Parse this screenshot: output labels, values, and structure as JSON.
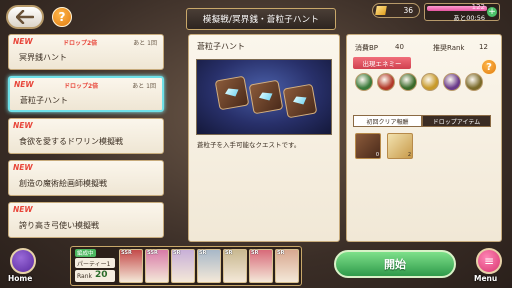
{
  "header": {
    "title": "模擬戦/冥界銭・蒼粒子ハント",
    "gems": "36",
    "stamina_value": "122",
    "stamina_fill": 1.0,
    "stamina_recovery": "あと00:56"
  },
  "quests": [
    {
      "new": "NEW",
      "drop": "ドロップ2倍",
      "remain": "あと 1回",
      "name": "冥界銭ハント"
    },
    {
      "new": "NEW",
      "drop": "ドロップ2倍",
      "remain": "あと 1回",
      "name": "蒼粒子ハント"
    },
    {
      "new": "NEW",
      "drop": "",
      "remain": "",
      "name": "食欲を愛するドワリン模擬戦"
    },
    {
      "new": "NEW",
      "drop": "",
      "remain": "",
      "name": "創造の魔術絵画師模擬戦"
    },
    {
      "new": "NEW",
      "drop": "",
      "remain": "",
      "name": "誇り高き弓使い模擬戦"
    }
  ],
  "detail": {
    "title": "蒼粒子ハント",
    "description": "蒼粒子を入手可能なクエストです。"
  },
  "info": {
    "bp_label": "消費BP",
    "bp_value": "40",
    "rank_label": "推奨Rank",
    "rank_value": "12",
    "enemy_label": "出現エネミー",
    "enemy_colors": [
      "#3a7a3a",
      "#b23a2a",
      "#3a6a2a",
      "#c89a2a",
      "#6a3a8a",
      "#7a6a2a"
    ],
    "tab_first_clear": "初回クリア報酬",
    "tab_drop_items": "ドロップアイテム",
    "drop_items": [
      {
        "type": "card-icon",
        "count": "0"
      },
      {
        "type": "scroll-icon",
        "count": "2"
      }
    ]
  },
  "party": {
    "tag": "編成中",
    "name": "パーティー1",
    "rank_label": "Rank",
    "rank_value": "20",
    "members": [
      {
        "rarity": "SSR",
        "color": "#c44a4a"
      },
      {
        "rarity": "SSR",
        "color": "#d87aa8"
      },
      {
        "rarity": "SR",
        "color": "#c8b0d8"
      },
      {
        "rarity": "SR",
        "color": "#a8b8c8"
      },
      {
        "rarity": "SR",
        "color": "#c8b890"
      },
      {
        "rarity": "SR",
        "color": "#d86a7a"
      },
      {
        "rarity": "SR",
        "color": "#d8a890"
      }
    ]
  },
  "buttons": {
    "home": "Home",
    "start": "開始",
    "menu": "Menu"
  }
}
